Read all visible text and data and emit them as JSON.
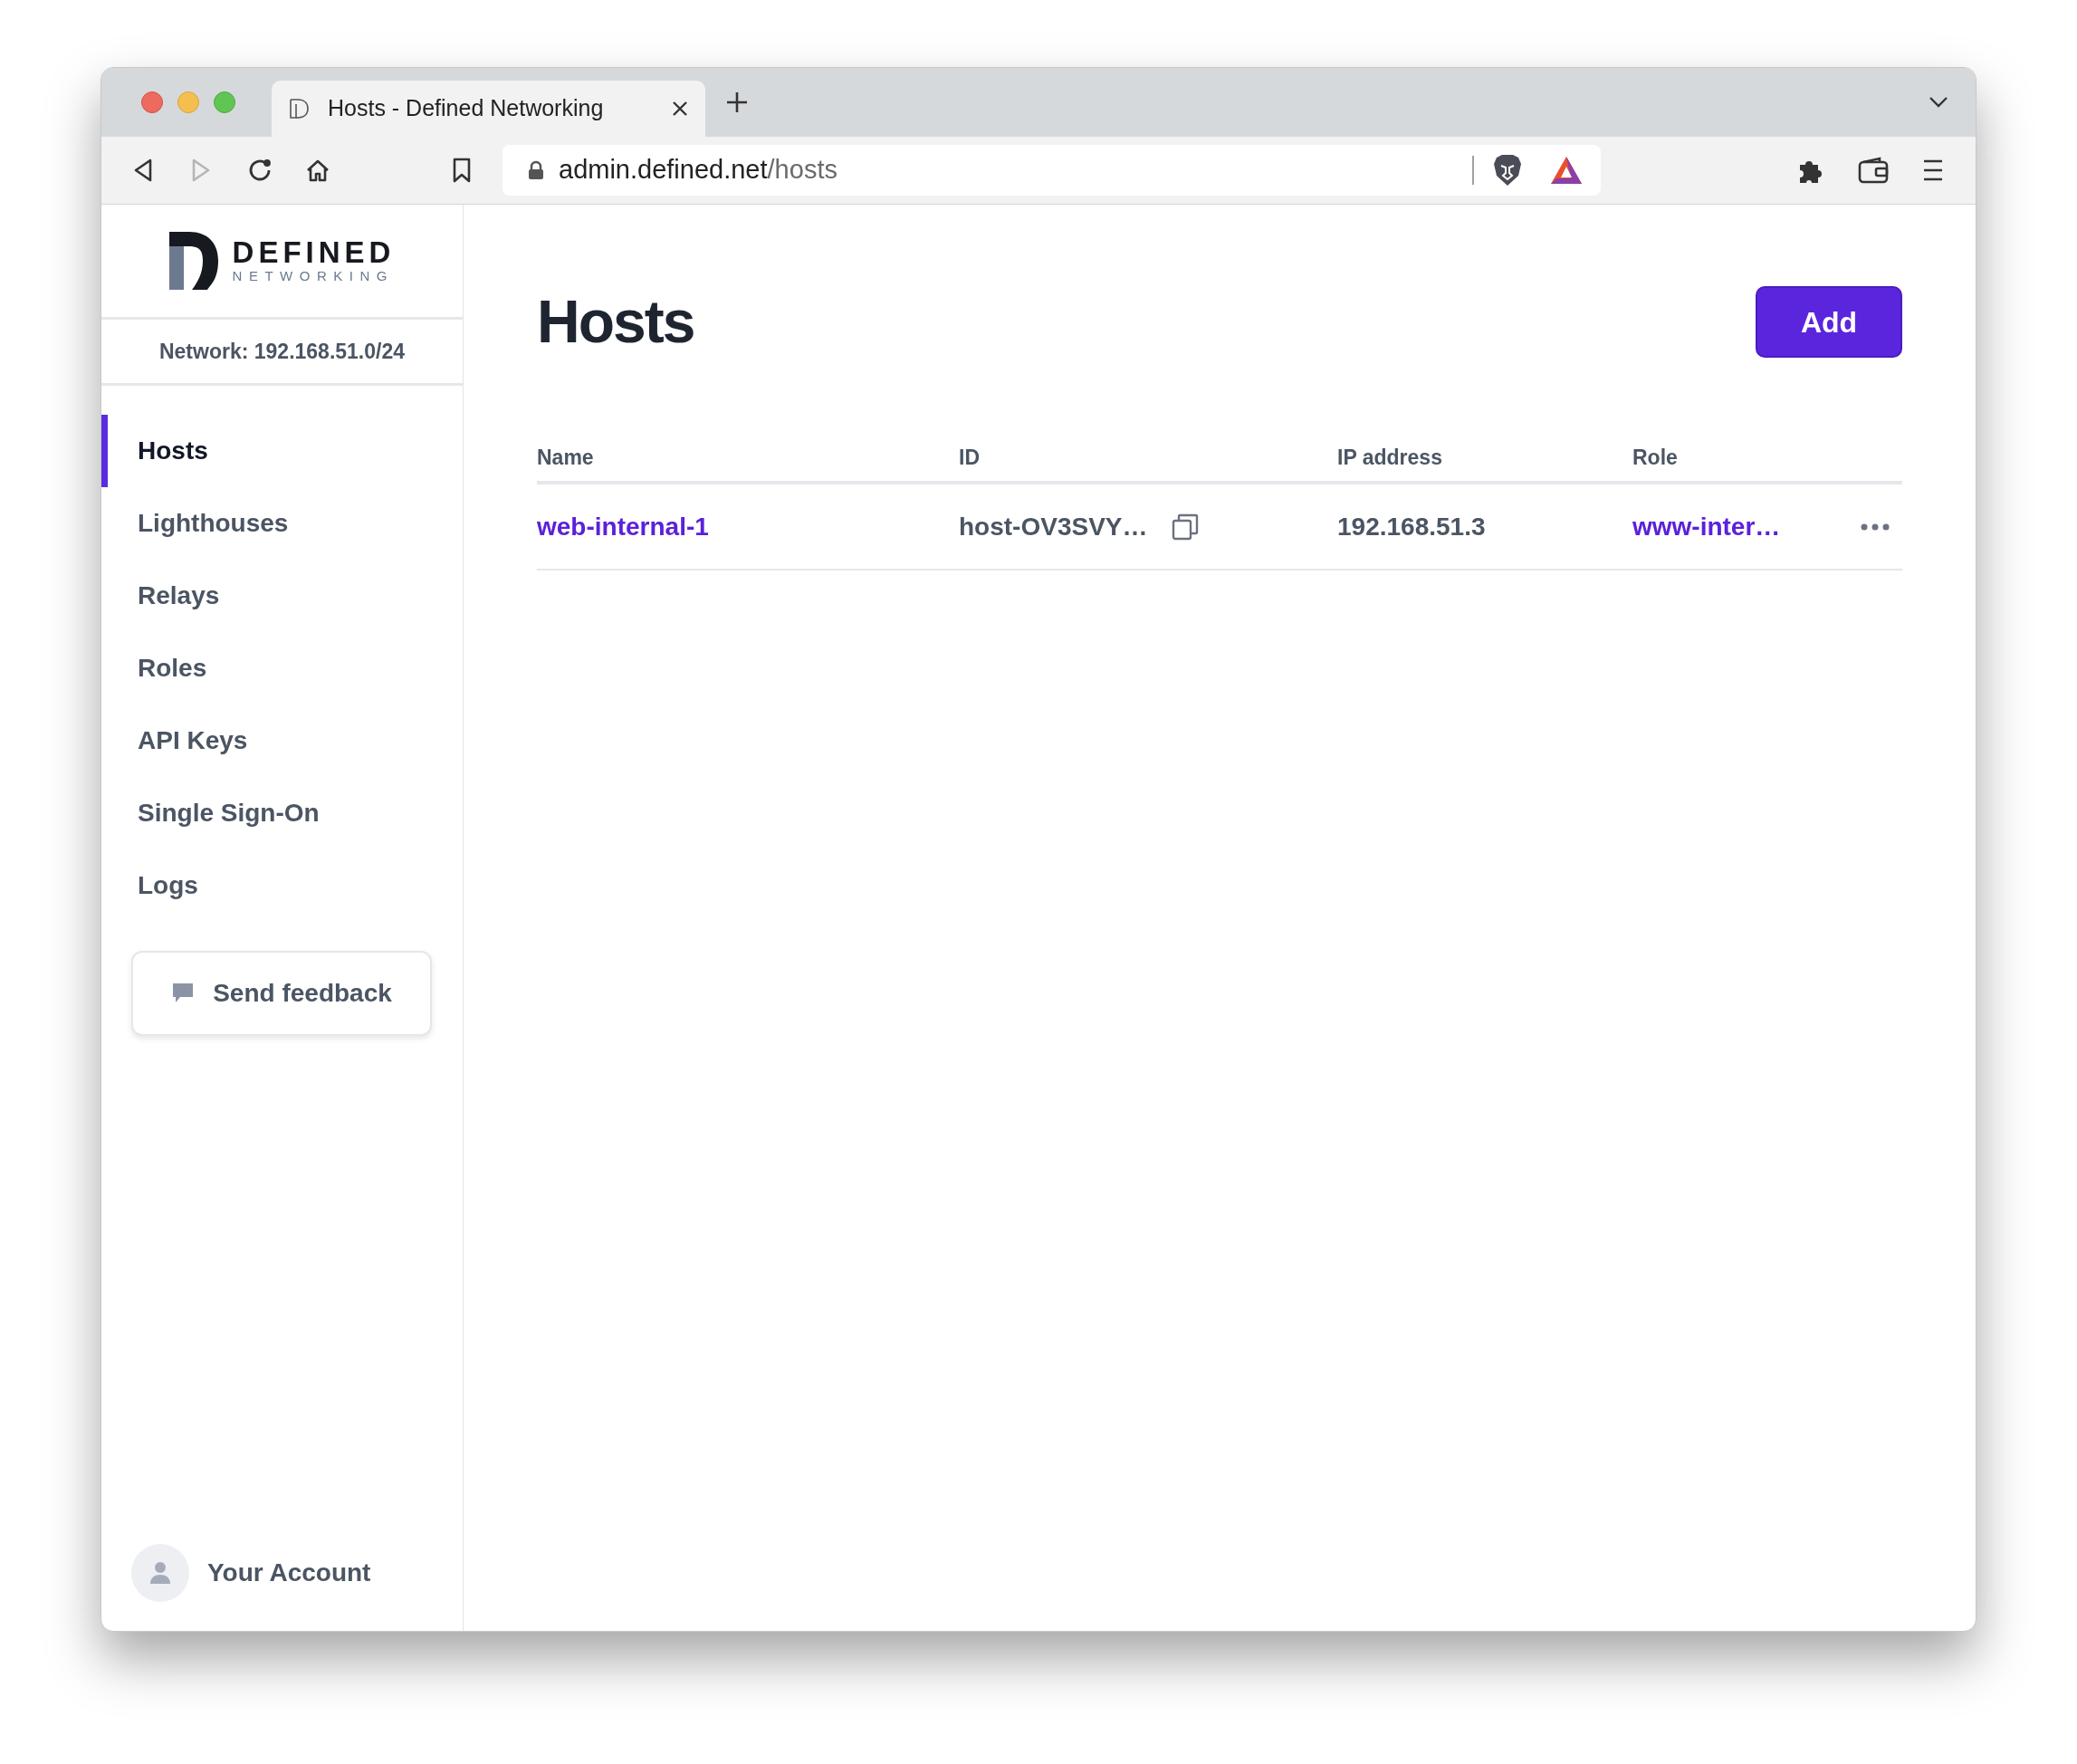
{
  "browser": {
    "tab_title": "Hosts - Defined Networking",
    "url_host": "admin.defined.net",
    "url_path": "/hosts"
  },
  "sidebar": {
    "logo": {
      "name": "DEFINED",
      "tagline": "NETWORKING"
    },
    "network": "Network: 192.168.51.0/24",
    "items": [
      {
        "label": "Hosts",
        "selected": true
      },
      {
        "label": "Lighthouses",
        "selected": false
      },
      {
        "label": "Relays",
        "selected": false
      },
      {
        "label": "Roles",
        "selected": false
      },
      {
        "label": "API Keys",
        "selected": false
      },
      {
        "label": "Single Sign-On",
        "selected": false
      },
      {
        "label": "Logs",
        "selected": false
      }
    ],
    "feedback_button": "Send feedback",
    "account": "Your Account"
  },
  "page": {
    "title": "Hosts",
    "add_button": "Add"
  },
  "table": {
    "columns": [
      "Name",
      "ID",
      "IP address",
      "Role"
    ],
    "rows": [
      {
        "name": "web-internal-1",
        "id": "host-OV3SVY…",
        "ip": "192.168.51.3",
        "role": "www-inter…"
      }
    ]
  }
}
